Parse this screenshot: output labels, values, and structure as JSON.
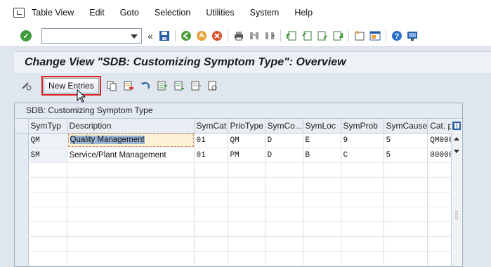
{
  "menu": {
    "items": [
      "Table View",
      "Edit",
      "Goto",
      "Selection",
      "Utilities",
      "System",
      "Help"
    ]
  },
  "toolbar": {
    "command_value": "",
    "icons": [
      "back-icon",
      "exit-icon",
      "cancel-icon",
      "print-icon",
      "find-icon",
      "find-next-icon",
      "first-page-icon",
      "previous-page-icon",
      "next-page-icon",
      "last-page-icon",
      "create-session-icon",
      "shortcut-icon",
      "help-icon",
      "customize-layout-icon"
    ]
  },
  "title": "Change View \"SDB: Customizing Symptom Type\": Overview",
  "app_toolbar": {
    "new_entries_label": "New Entries"
  },
  "table": {
    "title": "SDB: Customizing Symptom Type",
    "columns": [
      "SymTyp",
      "Description",
      "SymCat",
      "PrioType",
      "SymCo...",
      "SymLoc",
      "SymProb",
      "SymCause",
      "Cat. p"
    ],
    "rows": [
      [
        "QM",
        "Quality Management",
        "01",
        "QM",
        "D",
        "E",
        "9",
        "5",
        "QM000"
      ],
      [
        "SM",
        "Service/Plant Management",
        "01",
        "PM",
        "D",
        "B",
        "C",
        "5",
        "00000"
      ]
    ]
  },
  "colors": {
    "highlight_outline": "#dd2222",
    "title_background": "#eef2f6",
    "selection_blue": "#9cb5d6"
  }
}
